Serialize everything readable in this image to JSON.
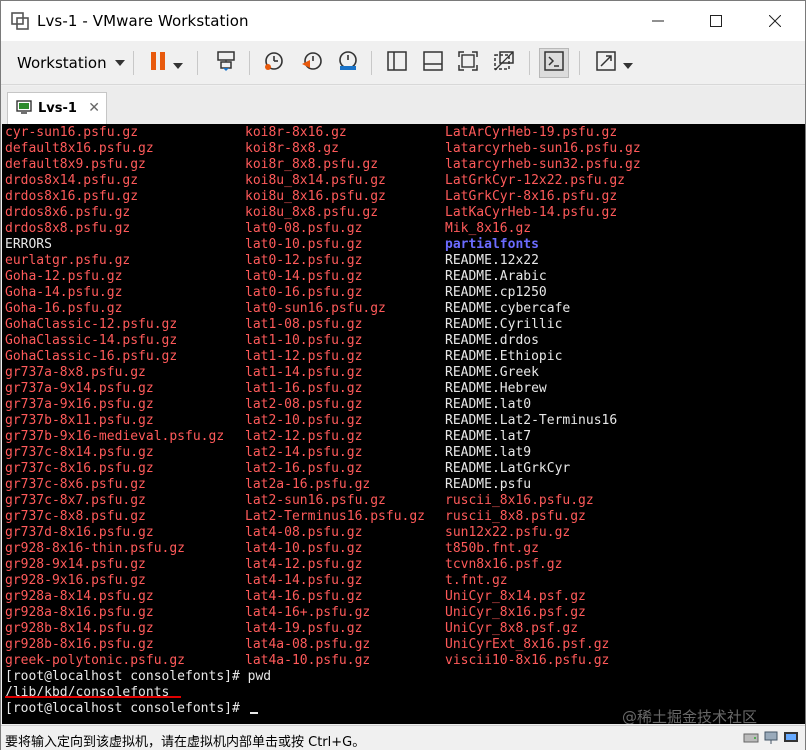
{
  "window": {
    "title": "Lvs-1 - VMware Workstation",
    "min_label": "—",
    "max_label": "☐",
    "close_label": "✕"
  },
  "toolbar": {
    "workstation_menu": "Workstation",
    "icons": [
      "pause-icon",
      "send-ctrl-alt-del-icon",
      "snapshot-take-icon",
      "snapshot-revert-icon",
      "snapshot-manager-icon",
      "sidebar-toggle-icon",
      "thumbnail-bar-icon",
      "fullscreen-icon",
      "unity-icon",
      "console-view-icon",
      "stretch-guest-icon"
    ]
  },
  "tab": {
    "label": "Lvs-1",
    "close": "✕"
  },
  "terminal": {
    "col1": [
      {
        "t": "cyr-sun16.psfu.gz",
        "c": "red"
      },
      {
        "t": "default8x16.psfu.gz",
        "c": "red"
      },
      {
        "t": "default8x9.psfu.gz",
        "c": "red"
      },
      {
        "t": "drdos8x14.psfu.gz",
        "c": "red"
      },
      {
        "t": "drdos8x16.psfu.gz",
        "c": "red"
      },
      {
        "t": "drdos8x6.psfu.gz",
        "c": "red"
      },
      {
        "t": "drdos8x8.psfu.gz",
        "c": "red"
      },
      {
        "t": "ERRORS",
        "c": "white"
      },
      {
        "t": "eurlatgr.psfu.gz",
        "c": "red"
      },
      {
        "t": "Goha-12.psfu.gz",
        "c": "red"
      },
      {
        "t": "Goha-14.psfu.gz",
        "c": "red"
      },
      {
        "t": "Goha-16.psfu.gz",
        "c": "red"
      },
      {
        "t": "GohaClassic-12.psfu.gz",
        "c": "red"
      },
      {
        "t": "GohaClassic-14.psfu.gz",
        "c": "red"
      },
      {
        "t": "GohaClassic-16.psfu.gz",
        "c": "red"
      },
      {
        "t": "gr737a-8x8.psfu.gz",
        "c": "red"
      },
      {
        "t": "gr737a-9x14.psfu.gz",
        "c": "red"
      },
      {
        "t": "gr737a-9x16.psfu.gz",
        "c": "red"
      },
      {
        "t": "gr737b-8x11.psfu.gz",
        "c": "red"
      },
      {
        "t": "gr737b-9x16-medieval.psfu.gz",
        "c": "red"
      },
      {
        "t": "gr737c-8x14.psfu.gz",
        "c": "red"
      },
      {
        "t": "gr737c-8x16.psfu.gz",
        "c": "red"
      },
      {
        "t": "gr737c-8x6.psfu.gz",
        "c": "red"
      },
      {
        "t": "gr737c-8x7.psfu.gz",
        "c": "red"
      },
      {
        "t": "gr737c-8x8.psfu.gz",
        "c": "red"
      },
      {
        "t": "gr737d-8x16.psfu.gz",
        "c": "red"
      },
      {
        "t": "gr928-8x16-thin.psfu.gz",
        "c": "red"
      },
      {
        "t": "gr928-9x14.psfu.gz",
        "c": "red"
      },
      {
        "t": "gr928-9x16.psfu.gz",
        "c": "red"
      },
      {
        "t": "gr928a-8x14.psfu.gz",
        "c": "red"
      },
      {
        "t": "gr928a-8x16.psfu.gz",
        "c": "red"
      },
      {
        "t": "gr928b-8x14.psfu.gz",
        "c": "red"
      },
      {
        "t": "gr928b-8x16.psfu.gz",
        "c": "red"
      },
      {
        "t": "greek-polytonic.psfu.gz",
        "c": "red"
      }
    ],
    "col2": [
      {
        "t": "koi8r-8x16.gz",
        "c": "red"
      },
      {
        "t": "koi8r-8x8.gz",
        "c": "red"
      },
      {
        "t": "koi8r_8x8.psfu.gz",
        "c": "red"
      },
      {
        "t": "koi8u_8x14.psfu.gz",
        "c": "red"
      },
      {
        "t": "koi8u_8x16.psfu.gz",
        "c": "red"
      },
      {
        "t": "koi8u_8x8.psfu.gz",
        "c": "red"
      },
      {
        "t": "lat0-08.psfu.gz",
        "c": "red"
      },
      {
        "t": "lat0-10.psfu.gz",
        "c": "red"
      },
      {
        "t": "lat0-12.psfu.gz",
        "c": "red"
      },
      {
        "t": "lat0-14.psfu.gz",
        "c": "red"
      },
      {
        "t": "lat0-16.psfu.gz",
        "c": "red"
      },
      {
        "t": "lat0-sun16.psfu.gz",
        "c": "red"
      },
      {
        "t": "lat1-08.psfu.gz",
        "c": "red"
      },
      {
        "t": "lat1-10.psfu.gz",
        "c": "red"
      },
      {
        "t": "lat1-12.psfu.gz",
        "c": "red"
      },
      {
        "t": "lat1-14.psfu.gz",
        "c": "red"
      },
      {
        "t": "lat1-16.psfu.gz",
        "c": "red"
      },
      {
        "t": "lat2-08.psfu.gz",
        "c": "red"
      },
      {
        "t": "lat2-10.psfu.gz",
        "c": "red"
      },
      {
        "t": "lat2-12.psfu.gz",
        "c": "red"
      },
      {
        "t": "lat2-14.psfu.gz",
        "c": "red"
      },
      {
        "t": "lat2-16.psfu.gz",
        "c": "red"
      },
      {
        "t": "lat2a-16.psfu.gz",
        "c": "red"
      },
      {
        "t": "lat2-sun16.psfu.gz",
        "c": "red"
      },
      {
        "t": "Lat2-Terminus16.psfu.gz",
        "c": "red"
      },
      {
        "t": "lat4-08.psfu.gz",
        "c": "red"
      },
      {
        "t": "lat4-10.psfu.gz",
        "c": "red"
      },
      {
        "t": "lat4-12.psfu.gz",
        "c": "red"
      },
      {
        "t": "lat4-14.psfu.gz",
        "c": "red"
      },
      {
        "t": "lat4-16.psfu.gz",
        "c": "red"
      },
      {
        "t": "lat4-16+.psfu.gz",
        "c": "red"
      },
      {
        "t": "lat4-19.psfu.gz",
        "c": "red"
      },
      {
        "t": "lat4a-08.psfu.gz",
        "c": "red"
      },
      {
        "t": "lat4a-10.psfu.gz",
        "c": "red"
      }
    ],
    "col3": [
      {
        "t": "LatArCyrHeb-19.psfu.gz",
        "c": "red"
      },
      {
        "t": "latarcyrheb-sun16.psfu.gz",
        "c": "red"
      },
      {
        "t": "latarcyrheb-sun32.psfu.gz",
        "c": "red"
      },
      {
        "t": "LatGrkCyr-12x22.psfu.gz",
        "c": "red"
      },
      {
        "t": "LatGrkCyr-8x16.psfu.gz",
        "c": "red"
      },
      {
        "t": "LatKaCyrHeb-14.psfu.gz",
        "c": "red"
      },
      {
        "t": "Mik_8x16.gz",
        "c": "red"
      },
      {
        "t": "partialfonts",
        "c": "blue"
      },
      {
        "t": "README.12x22",
        "c": "white"
      },
      {
        "t": "README.Arabic",
        "c": "white"
      },
      {
        "t": "README.cp1250",
        "c": "white"
      },
      {
        "t": "README.cybercafe",
        "c": "white"
      },
      {
        "t": "README.Cyrillic",
        "c": "white"
      },
      {
        "t": "README.drdos",
        "c": "white"
      },
      {
        "t": "README.Ethiopic",
        "c": "white"
      },
      {
        "t": "README.Greek",
        "c": "white"
      },
      {
        "t": "README.Hebrew",
        "c": "white"
      },
      {
        "t": "README.lat0",
        "c": "white"
      },
      {
        "t": "README.Lat2-Terminus16",
        "c": "white"
      },
      {
        "t": "README.lat7",
        "c": "white"
      },
      {
        "t": "README.lat9",
        "c": "white"
      },
      {
        "t": "README.LatGrkCyr",
        "c": "white"
      },
      {
        "t": "README.psfu",
        "c": "white"
      },
      {
        "t": "ruscii_8x16.psfu.gz",
        "c": "red"
      },
      {
        "t": "ruscii_8x8.psfu.gz",
        "c": "red"
      },
      {
        "t": "sun12x22.psfu.gz",
        "c": "red"
      },
      {
        "t": "t850b.fnt.gz",
        "c": "red"
      },
      {
        "t": "tcvn8x16.psf.gz",
        "c": "red"
      },
      {
        "t": "t.fnt.gz",
        "c": "red"
      },
      {
        "t": "UniCyr_8x14.psf.gz",
        "c": "red"
      },
      {
        "t": "UniCyr_8x16.psf.gz",
        "c": "red"
      },
      {
        "t": "UniCyr_8x8.psf.gz",
        "c": "red"
      },
      {
        "t": "UniCyrExt_8x16.psf.gz",
        "c": "red"
      },
      {
        "t": "viscii10-8x16.psfu.gz",
        "c": "red"
      }
    ],
    "prompt_line_1": "[root@localhost consolefonts]# pwd",
    "pwd_output": "/lib/kbd/consolefonts",
    "prompt_line_2": "[root@localhost consolefonts]# ",
    "watermark": "@稀土掘金技术社区"
  },
  "status": {
    "text": "要将输入定向到该虚拟机，请在虚拟机内部单击或按 Ctrl+G。"
  },
  "colors": {
    "terminal_bg": "#000000",
    "file_red": "#ff5a5a",
    "dir_blue": "#6b6bff",
    "plain_white": "#e8e8e8",
    "pause_orange": "#e8590c"
  }
}
